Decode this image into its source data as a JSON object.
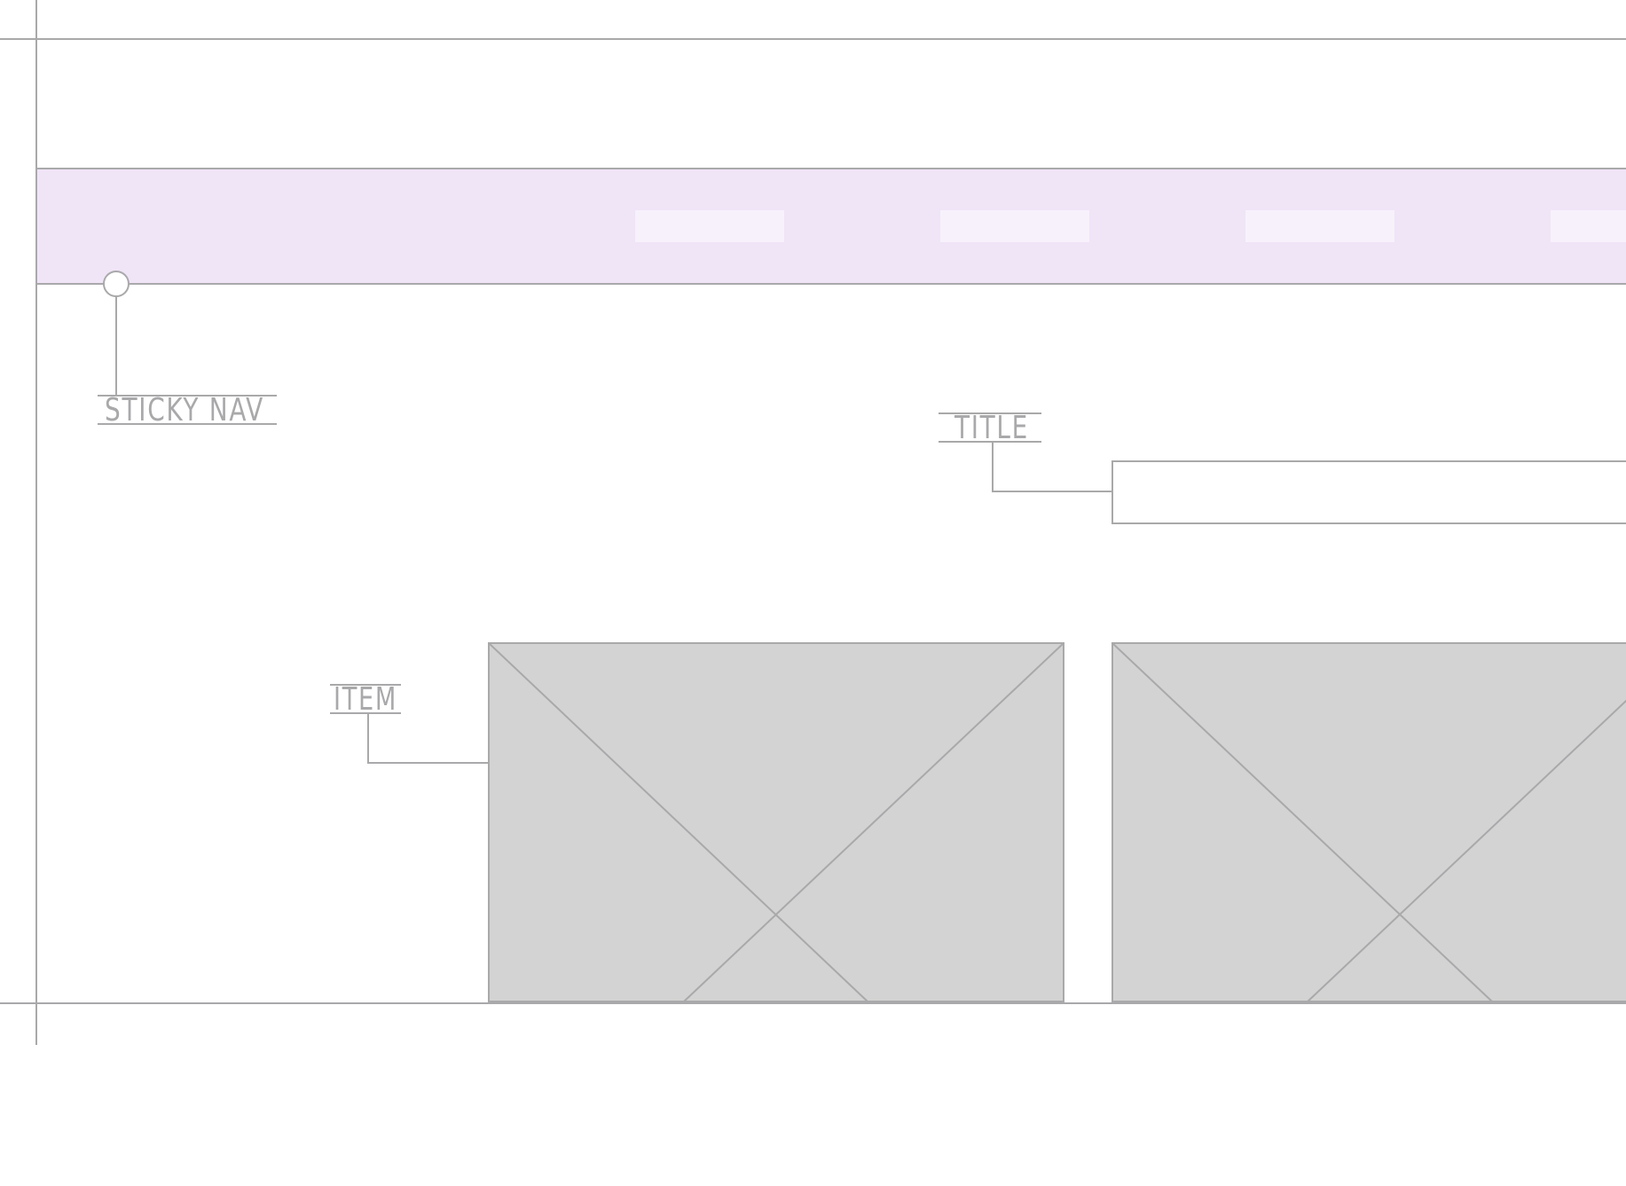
{
  "annotations": {
    "sticky_nav": "STICKY NAV",
    "title": "TITLE",
    "item": "ITEM"
  },
  "nav": {
    "link_slots": 4
  },
  "content": {
    "item_tiles": 2
  },
  "colors": {
    "guide_line": "#a9a9ab",
    "nav_band": "#f0e4f7",
    "nav_slot": "#f7f1fb",
    "placeholder_fill": "#d3d3d3",
    "background": "#ffffff"
  }
}
